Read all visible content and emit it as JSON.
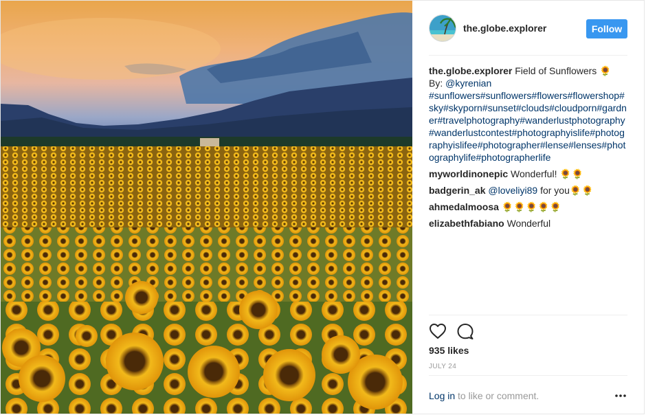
{
  "post": {
    "username": "the.globe.explorer",
    "follow_label": "Follow",
    "caption": {
      "author": "the.globe.explorer",
      "title": "Field of Sunflowers 🌻",
      "by_label": "By: ",
      "credit": "@kyrenian",
      "hashtags": "#sunflowers#sunflowers#flowers#flowershop#sky#skyporn#sunset#clouds#cloudporn#gardner#travelphotography#wanderlustphotography#wanderlustcontest#photographyislife#photographyislifee#photographer#lense#lenses#photographylife#photographerlife"
    },
    "comments": [
      {
        "author": "myworldinonepic",
        "pre": "Wonderful! 🌻🌻",
        "mention": "",
        "post": ""
      },
      {
        "author": "badgerin_ak",
        "pre": "",
        "mention": "@loveliyi89",
        "post": " for you🌻🌻"
      },
      {
        "author": "ahmedalmoosa",
        "pre": "🌻🌻🌻🌻🌻",
        "mention": "",
        "post": ""
      },
      {
        "author": "elizabethfabiano",
        "pre": "Wonderful",
        "mention": "",
        "post": ""
      }
    ],
    "likes": "935 likes",
    "date": "JULY 24",
    "login_link": "Log in",
    "login_rest": " to like or comment."
  },
  "icons": {
    "like": "heart-outline-icon",
    "comment": "speech-bubble-icon",
    "more": "more-options-icon"
  },
  "colors": {
    "follow_button": "#3897f0",
    "link": "#003569",
    "muted": "#999999"
  }
}
